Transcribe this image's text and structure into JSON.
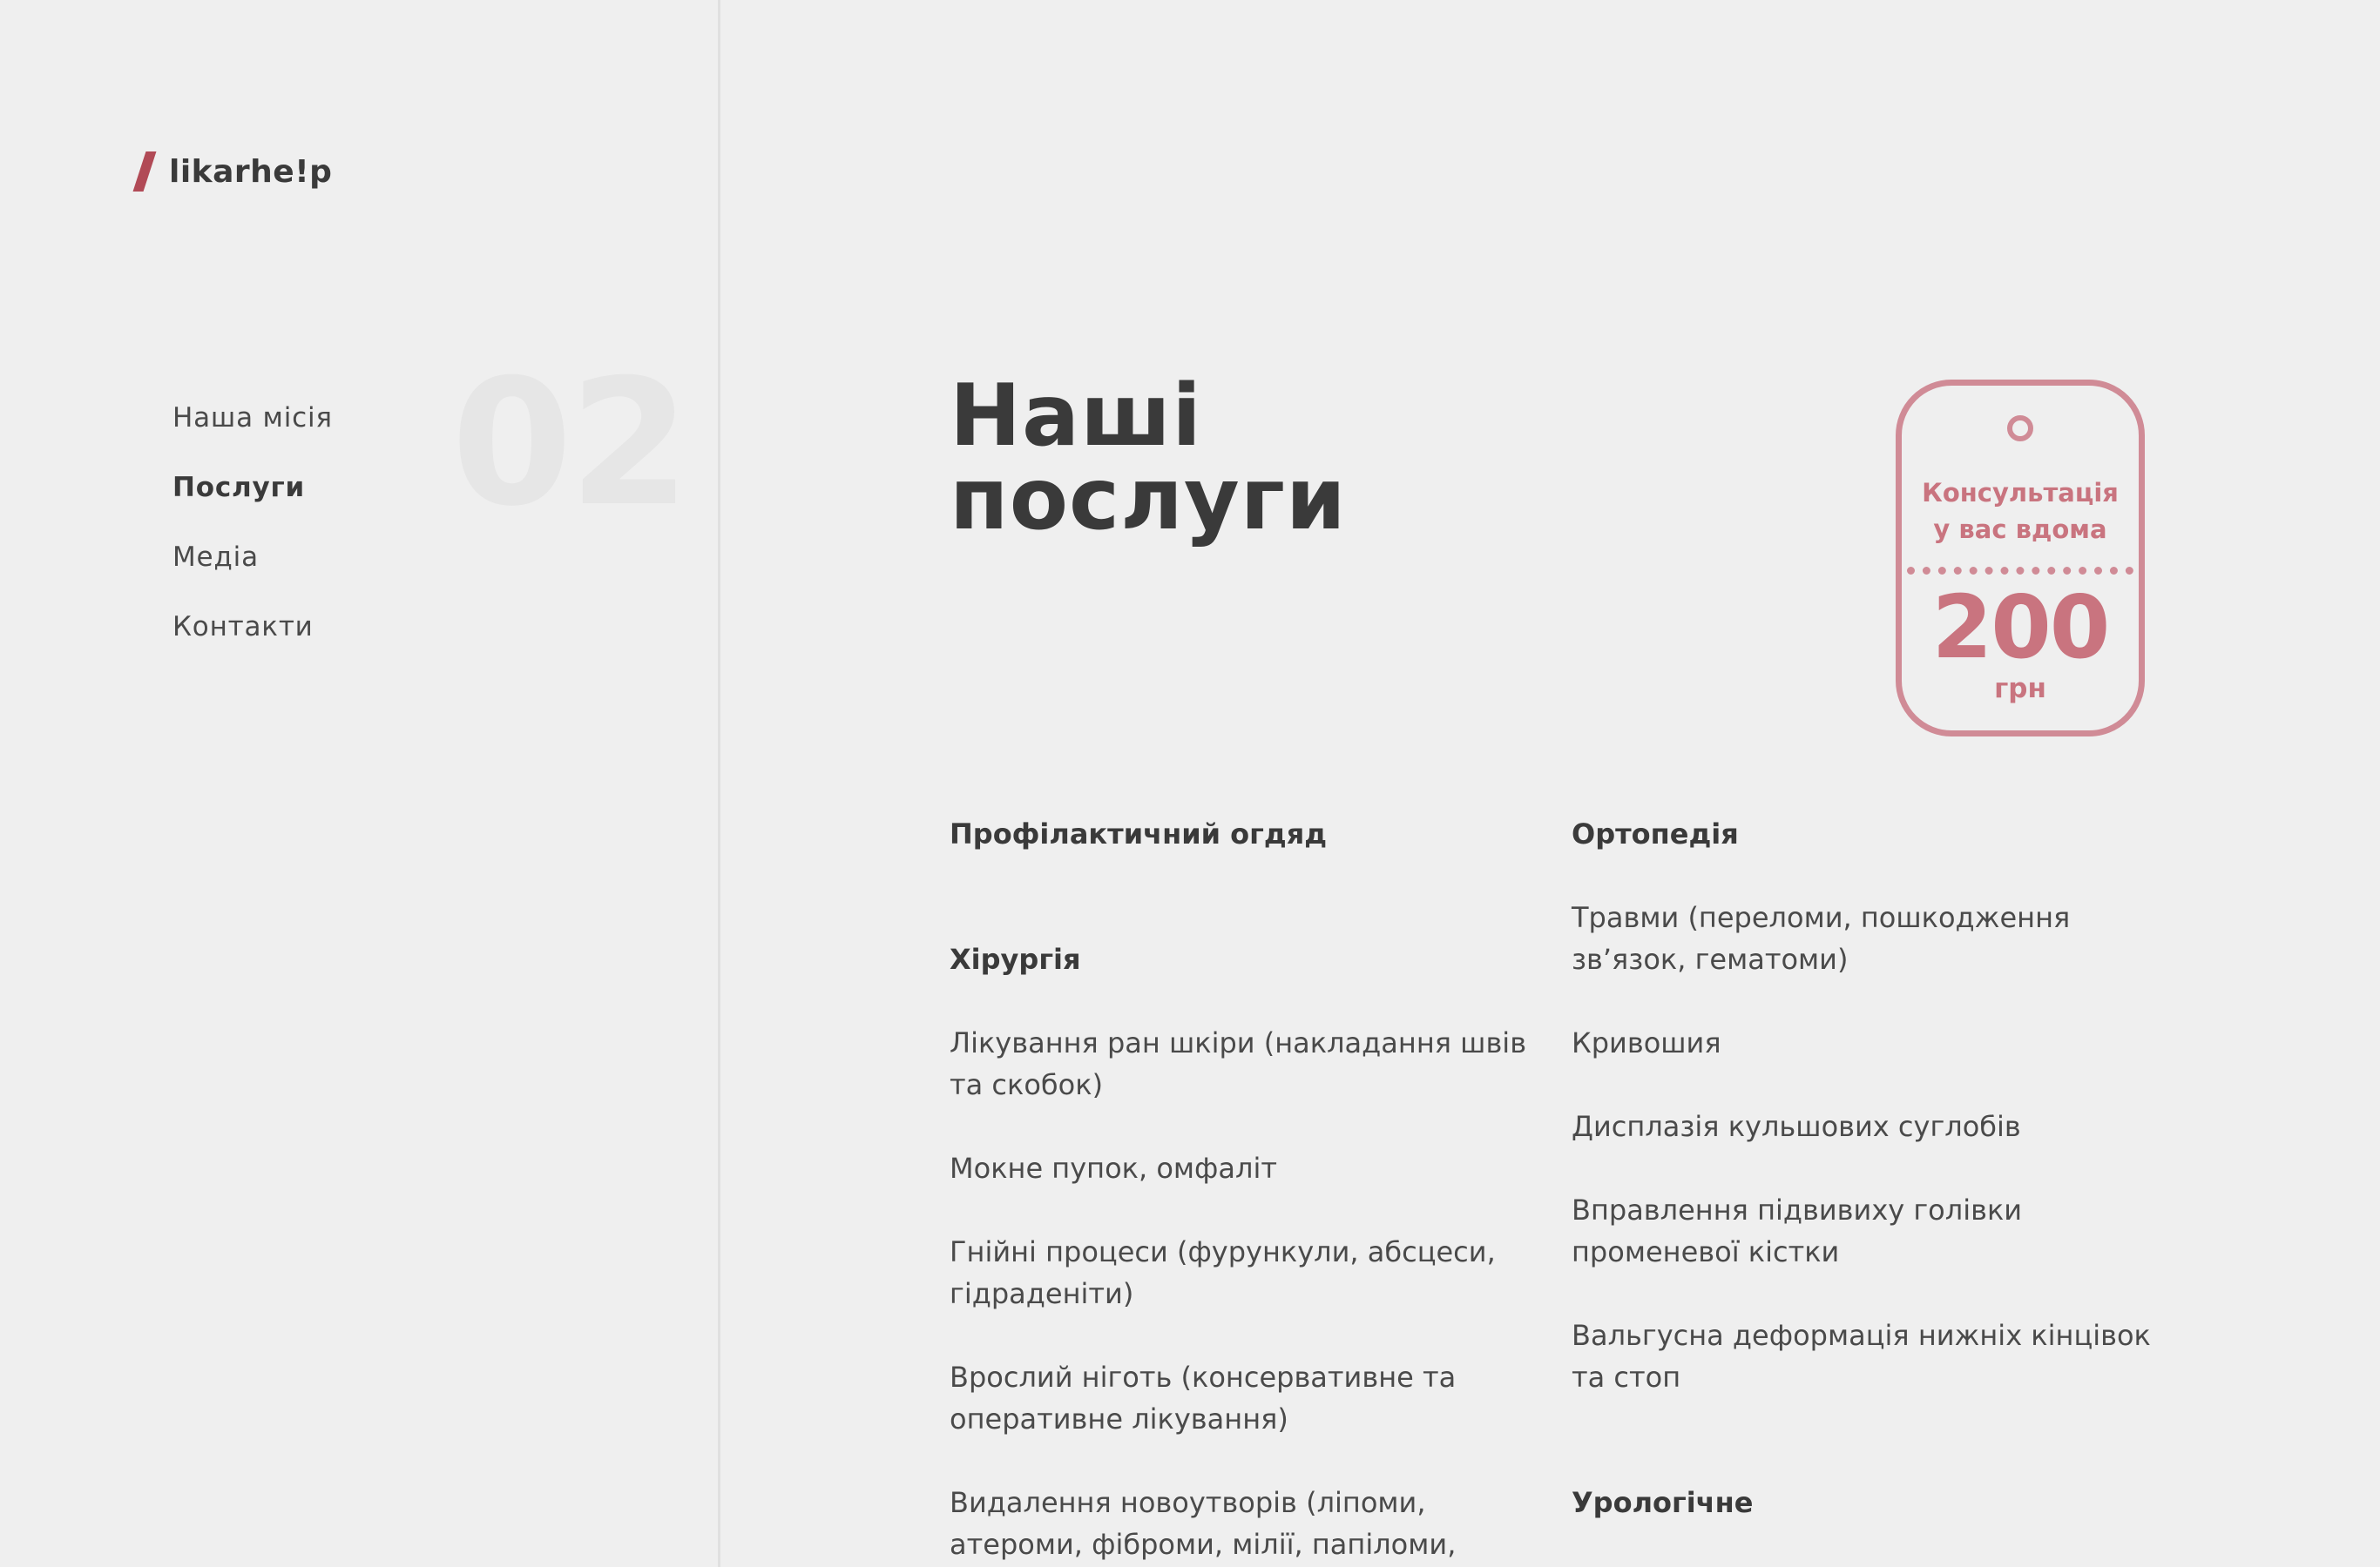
{
  "logo": {
    "text": "likarhe!p"
  },
  "section_number": "02",
  "nav": [
    {
      "label": "Наша місія",
      "active": false
    },
    {
      "label": "Послуги",
      "active": true
    },
    {
      "label": "Медіа",
      "active": false
    },
    {
      "label": "Контакти",
      "active": false
    }
  ],
  "title": {
    "line1": "Наші",
    "line2": "послуги"
  },
  "price_tag": {
    "line1": "Консультація",
    "line2": "у вас вдома",
    "price": "200",
    "currency": "грн"
  },
  "services": {
    "left": {
      "preventive_heading": "Профілактичний огдяд",
      "surgery_heading": "Хірургія",
      "surgery_items": [
        {
          "line1": "Лікування ран шкіри (накладання швів",
          "line2": "та скобок)"
        },
        {
          "line1": "Мокне пупок, омфаліт",
          "line2": ""
        },
        {
          "line1": "Гнійні процеси  (фурункули, абсцеси,",
          "line2": "гідраденіти)"
        },
        {
          "line1": "Врослий ніготь (консервативне та",
          "line2": "оперативне лікування)"
        },
        {
          "line1": "Видалення новоутворів (ліпоми,",
          "line2": "атероми, фіброми, мілії, папіломи,"
        }
      ]
    },
    "right": {
      "orthopedics_heading": "Ортопедія",
      "orthopedics_items": [
        {
          "line1": "Травми (переломи, пошкодження",
          "line2": "зв’язок, гематоми)"
        },
        {
          "line1": "Кривошия",
          "line2": ""
        },
        {
          "line1": "Дисплазія кульшових суглобів",
          "line2": ""
        },
        {
          "line1": "Вправлення підвивиху голівки",
          "line2": "променевої кістки"
        },
        {
          "line1": "Вальгусна деформація нижніх кінцівок",
          "line2": "та стоп"
        }
      ],
      "urology_heading": "Урологічне"
    }
  },
  "colors": {
    "accent": "#b14a56",
    "tag": "#d08b96",
    "text": "#3a3a3a",
    "background": "#efefef"
  }
}
